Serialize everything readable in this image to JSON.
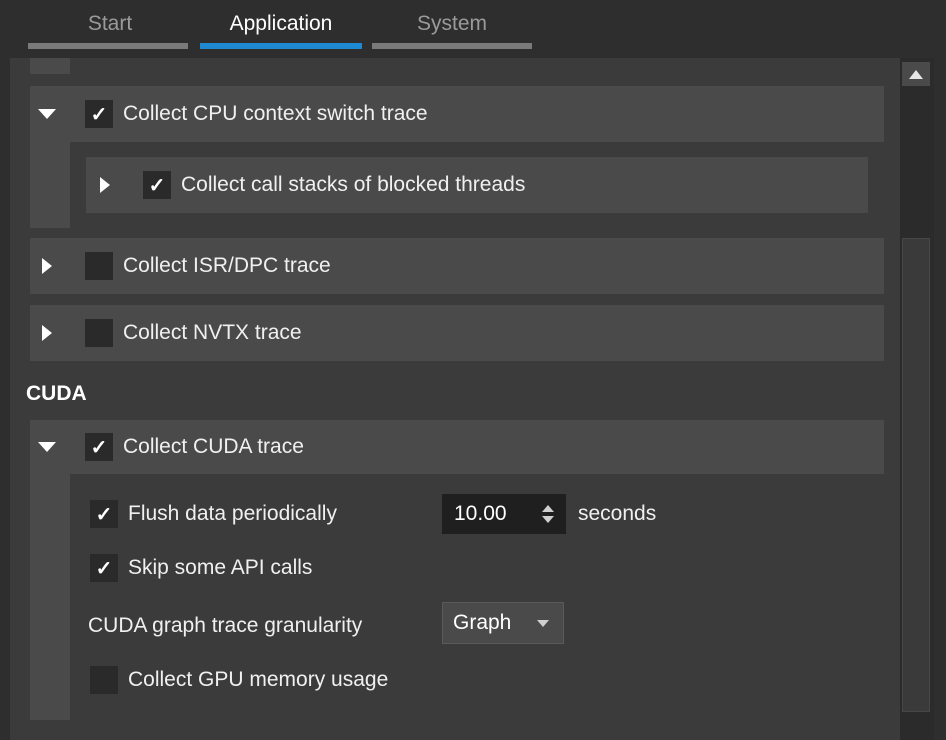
{
  "tabs": [
    {
      "label": "Start",
      "active": false
    },
    {
      "label": "Application",
      "active": true
    },
    {
      "label": "System",
      "active": false
    }
  ],
  "cpu": {
    "context_switch": {
      "label": "Collect CPU context switch trace",
      "checked": true,
      "expanded": true
    },
    "blocked_threads": {
      "label": "Collect call stacks of blocked threads",
      "checked": true,
      "expanded": false
    },
    "isr_dpc": {
      "label": "Collect ISR/DPC trace",
      "checked": false,
      "expanded": false
    },
    "nvtx": {
      "label": "Collect NVTX trace",
      "checked": false,
      "expanded": false
    }
  },
  "cuda": {
    "section_title": "CUDA",
    "trace": {
      "label": "Collect CUDA trace",
      "checked": true,
      "expanded": true
    },
    "flush": {
      "label": "Flush data periodically",
      "checked": true,
      "value": "10.00",
      "unit": "seconds"
    },
    "skip_api": {
      "label": "Skip some API calls",
      "checked": true
    },
    "graph_granularity": {
      "label": "CUDA graph trace granularity",
      "selected": "Graph"
    },
    "gpu_memory": {
      "label": "Collect GPU memory usage",
      "checked": false
    }
  },
  "glyphs": {
    "check": "✓"
  },
  "colors": {
    "accent": "#1e88d0",
    "background": "#2e2e2e",
    "panel": "#3b3b3b",
    "row": "#4a4a4a"
  }
}
